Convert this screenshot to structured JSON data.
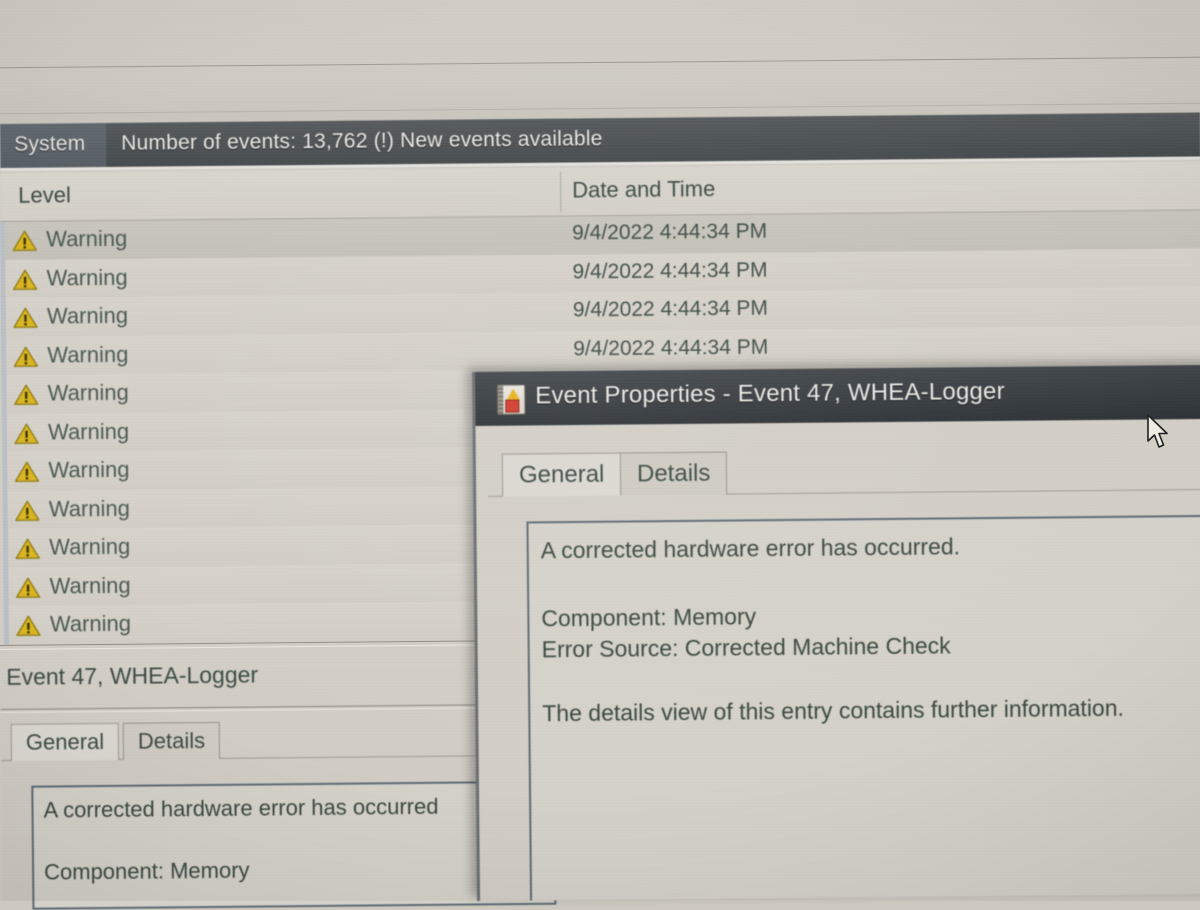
{
  "window": {
    "log_name": "System",
    "events_summary": "Number of events: 13,762 (!) New events available"
  },
  "event_list": {
    "columns": [
      "Level",
      "Date and Time"
    ],
    "rows": [
      {
        "level": "Warning",
        "datetime": "9/4/2022 4:44:34 PM",
        "selected": true
      },
      {
        "level": "Warning",
        "datetime": "9/4/2022 4:44:34 PM",
        "selected": false
      },
      {
        "level": "Warning",
        "datetime": "9/4/2022 4:44:34 PM",
        "selected": false
      },
      {
        "level": "Warning",
        "datetime": "9/4/2022 4:44:34 PM",
        "selected": false
      },
      {
        "level": "Warning",
        "datetime": "",
        "selected": false
      },
      {
        "level": "Warning",
        "datetime": "",
        "selected": false
      },
      {
        "level": "Warning",
        "datetime": "",
        "selected": false
      },
      {
        "level": "Warning",
        "datetime": "",
        "selected": false
      },
      {
        "level": "Warning",
        "datetime": "",
        "selected": false
      },
      {
        "level": "Warning",
        "datetime": "",
        "selected": false
      },
      {
        "level": "Warning",
        "datetime": "",
        "selected": false
      }
    ]
  },
  "detail_pane": {
    "title": "Event 47, WHEA-Logger",
    "tabs": [
      {
        "label": "General",
        "active": true
      },
      {
        "label": "Details",
        "active": false
      }
    ],
    "description_lines": [
      "A corrected hardware error has occurred",
      "Component: Memory"
    ]
  },
  "dialog": {
    "title": "Event Properties - Event 47, WHEA-Logger",
    "icon": "event-log-icon",
    "tabs": [
      {
        "label": "General",
        "active": true
      },
      {
        "label": "Details",
        "active": false
      }
    ],
    "description_lines": [
      "A corrected hardware error has occurred.",
      "Component: Memory",
      "Error Source: Corrected Machine Check",
      "The details view of this entry contains further information."
    ]
  },
  "colors": {
    "title_bar": "#2e3337",
    "header_bar": "#4e5355",
    "warning_icon": "#d9b520",
    "window_bg": "#d2cec6",
    "text": "#3c4a44"
  },
  "cursor": {
    "icon": "mouse-pointer-icon"
  }
}
